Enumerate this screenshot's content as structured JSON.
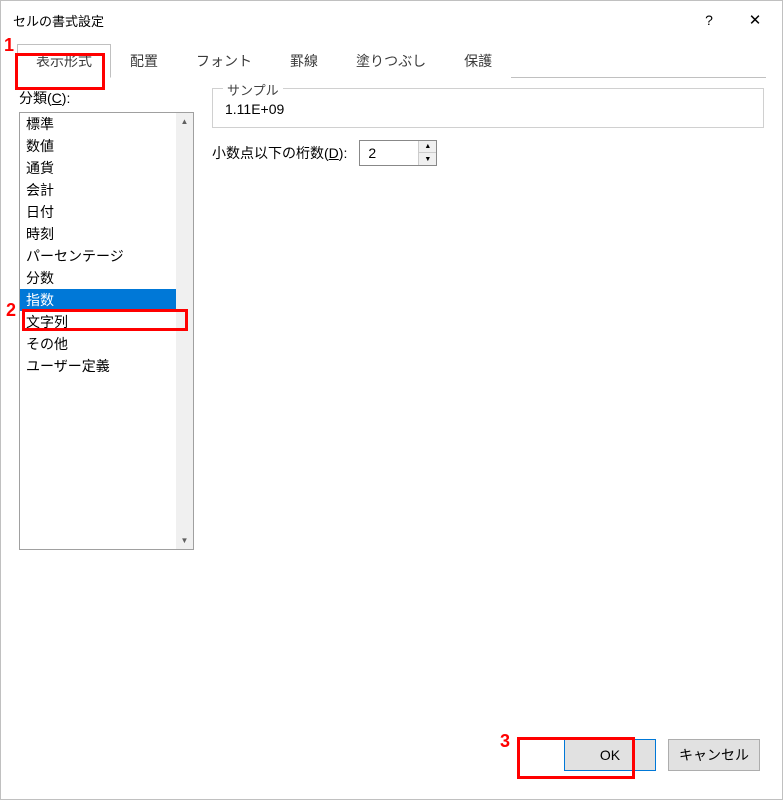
{
  "window": {
    "title": "セルの書式設定"
  },
  "tabs": [
    {
      "label": "表示形式",
      "active": true
    },
    {
      "label": "配置"
    },
    {
      "label": "フォント"
    },
    {
      "label": "罫線"
    },
    {
      "label": "塗りつぶし"
    },
    {
      "label": "保護"
    }
  ],
  "category": {
    "label_prefix": "分類(",
    "label_hotkey": "C",
    "label_suffix": "):",
    "items": [
      "標準",
      "数値",
      "通貨",
      "会計",
      "日付",
      "時刻",
      "パーセンテージ",
      "分数",
      "指数",
      "文字列",
      "その他",
      "ユーザー定義"
    ],
    "selected_index": 8
  },
  "sample": {
    "legend": "サンプル",
    "value": "1.11E+09"
  },
  "decimal": {
    "label_prefix": "小数点以下の桁数(",
    "label_hotkey": "D",
    "label_suffix": "):",
    "value": "2"
  },
  "buttons": {
    "ok": "OK",
    "cancel": "キャンセル"
  },
  "annotations": {
    "a1": "1",
    "a2": "2",
    "a3": "3"
  }
}
